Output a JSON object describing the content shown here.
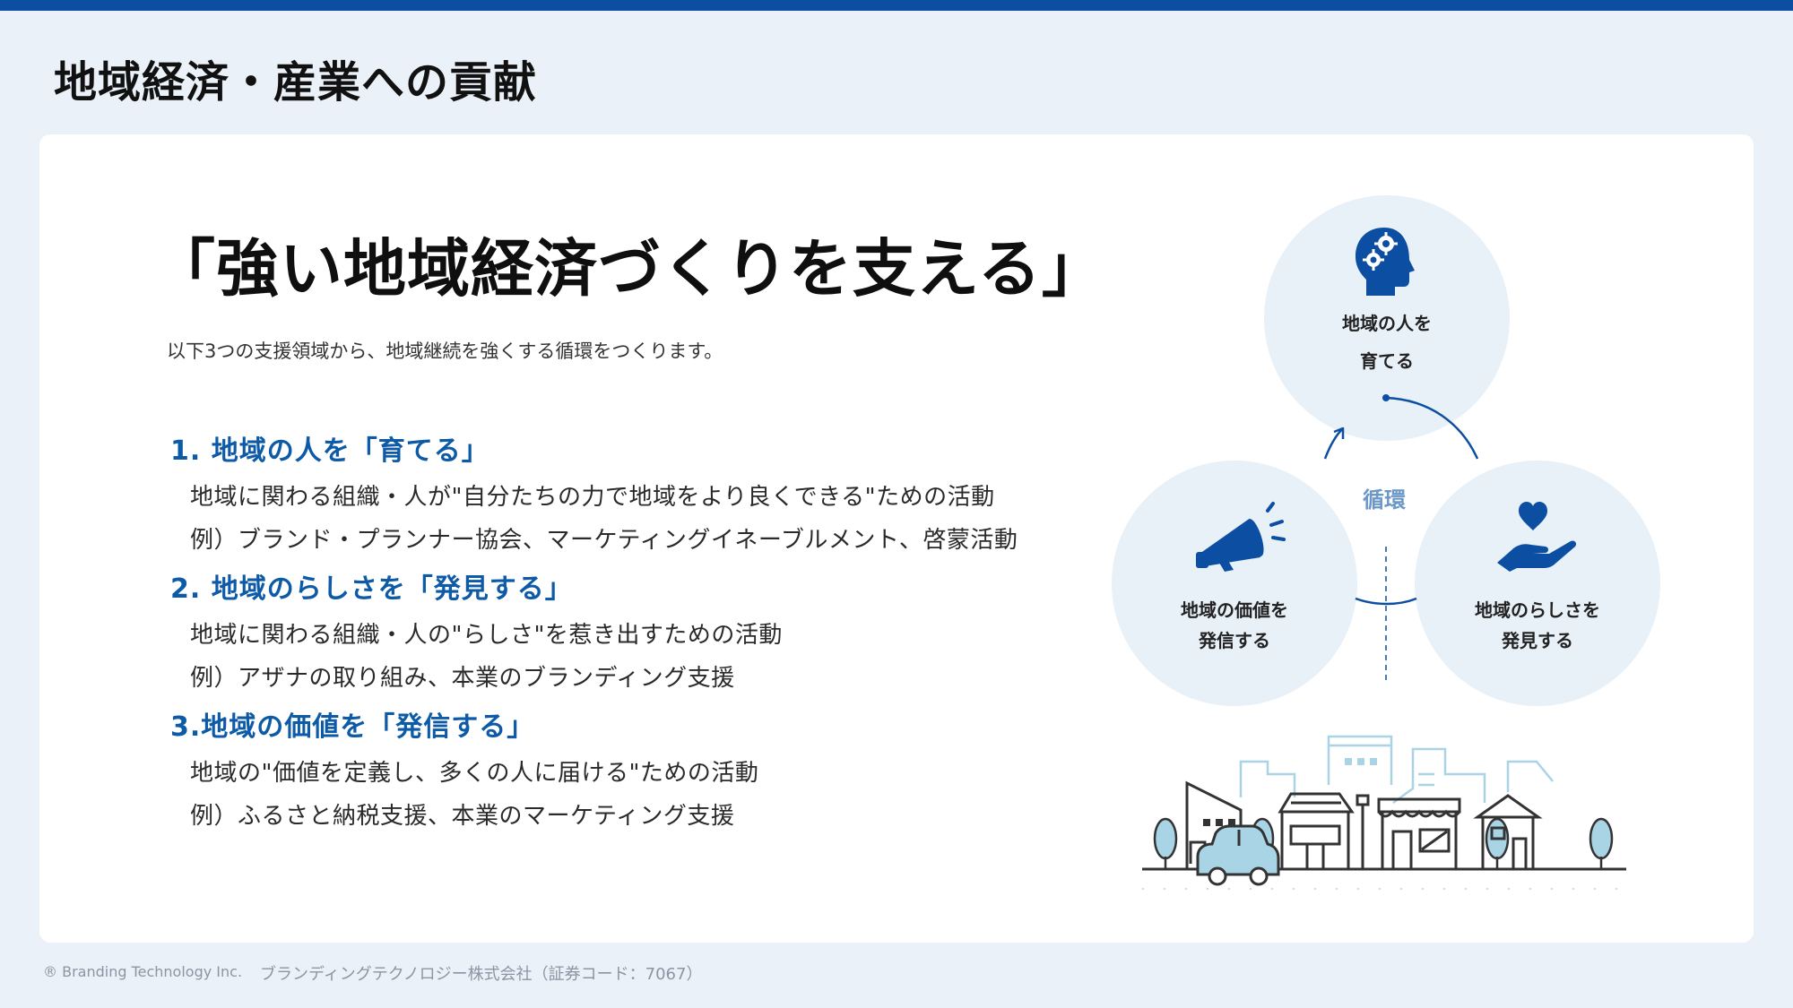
{
  "page": {
    "title": "地域経済・産業への貢献"
  },
  "main": {
    "headline": "「強い地域経済づくりを支える」",
    "lead": "以下3つの支援領域から、地域継続を強くする循環をつくります。",
    "sections": [
      {
        "heading": "1. 地域の人を「育てる」",
        "description": "地域に関わる組織・人が\"自分たちの力で地域をより良くできる\"ための活動",
        "example": "例）ブランド・プランナー協会、マーケティングイネーブルメント、啓蒙活動"
      },
      {
        "heading": "2. 地域のらしさを「発見する」",
        "description": "地域に関わる組織・人の\"らしさ\"を惹き出すための活動",
        "example": "例）アザナの取り組み、本業のブランディング支援"
      },
      {
        "heading": "3.地域の価値を「発信する」",
        "description": "地域の\"価値を定義し、多くの人に届ける\"ための活動",
        "example": "例）ふるさと納税支援、本業のマーケティング支援"
      }
    ]
  },
  "diagram": {
    "cycle_label": "循環",
    "nodes": [
      {
        "line1": "地域の人を",
        "line2": "育てる",
        "icon": "head-gears-icon"
      },
      {
        "line1": "地域の価値を",
        "line2": "発信する",
        "icon": "megaphone-icon"
      },
      {
        "line1": "地域のらしさを",
        "line2": "発見する",
        "icon": "hand-heart-icon"
      }
    ],
    "accent_color": "#0b4ea2",
    "illustration": "town-illustration"
  },
  "footer": {
    "copyright": "® Branding Technology Inc.",
    "company": "ブランディングテクノロジー株式会社（証券コード：7067）"
  }
}
